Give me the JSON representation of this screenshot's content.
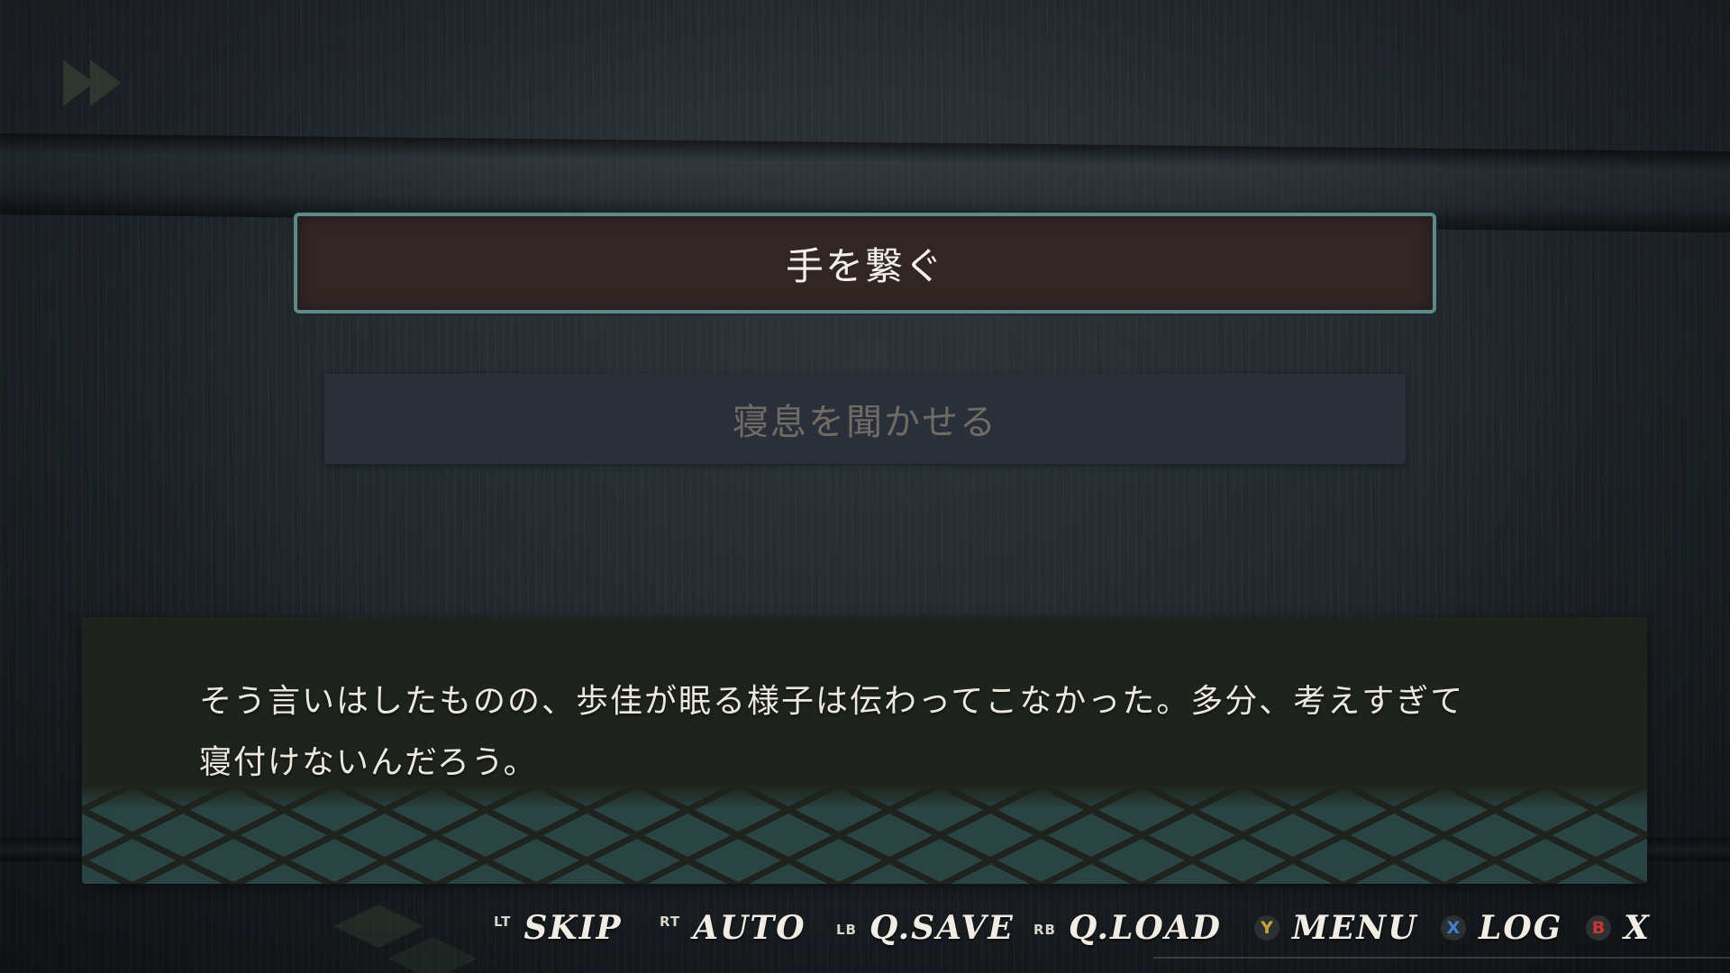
{
  "icons": {
    "fast_forward": "fast-forward-icon",
    "header_decoration": "lattice-pattern"
  },
  "choices": [
    {
      "label": "手を繋ぐ",
      "state": "selected"
    },
    {
      "label": "寝息を聞かせる",
      "state": "normal"
    }
  ],
  "dialogue": {
    "line1": "そう言いはしたものの、歩佳が眠る様子は伝わってこなかった。多分、考えすぎて",
    "line2": "寝付けないんだろう。"
  },
  "controls": [
    {
      "button": "LT",
      "label": "SKIP"
    },
    {
      "button": "RT",
      "label": "AUTO"
    },
    {
      "button": "LB",
      "label": "Q.SAVE"
    },
    {
      "button": "RB",
      "label": "Q.LOAD"
    },
    {
      "button": "Y",
      "label": "MENU",
      "color": "#c9a33a"
    },
    {
      "button": "X",
      "label": "LOG",
      "color": "#3f7fd1"
    },
    {
      "button": "B",
      "label": "X",
      "color": "#c8352e"
    }
  ],
  "colors": {
    "selected_choice_bg": "#322625",
    "selected_choice_border": "#5d8a87",
    "normal_choice_bg": "#2b2f3a",
    "dialogue_bg": "#1f231d",
    "lattice": "#2f4a49"
  }
}
